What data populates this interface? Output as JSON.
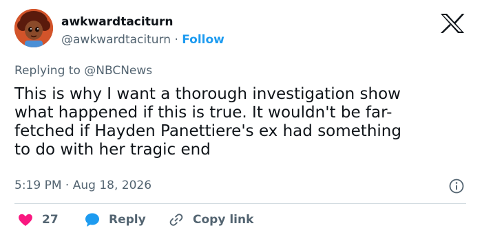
{
  "author": {
    "display_name": "awkwardtaciturn",
    "handle": "@awkwardtaciturn",
    "separator": "·",
    "follow_label": "Follow",
    "avatar_icon": "cartoon-avatar-icon"
  },
  "platform": {
    "logo_icon": "x-logo-icon"
  },
  "reply_context": {
    "prefix": "Replying to",
    "mention": "@NBCNews"
  },
  "tweet": {
    "lines": [
      "This is why I want a thorough investigation show",
      "what happened if this is true. It wouldn't be far-",
      "fetched if Hayden Panettiere's ex had something",
      "to do with her tragic end"
    ]
  },
  "meta": {
    "time": "5:19 PM",
    "separator": "·",
    "date": "Aug 18, 2026",
    "info_icon": "info-icon"
  },
  "actions": {
    "like_count": "27",
    "reply_label": "Reply",
    "copy_link_label": "Copy link",
    "icons": [
      "heart-icon",
      "reply-bubble-icon",
      "link-icon"
    ]
  },
  "colors": {
    "accent": "#1d9bf0",
    "like": "#f91880",
    "text": "#0f1419",
    "secondary": "#536471",
    "divider": "#cfd9de"
  }
}
